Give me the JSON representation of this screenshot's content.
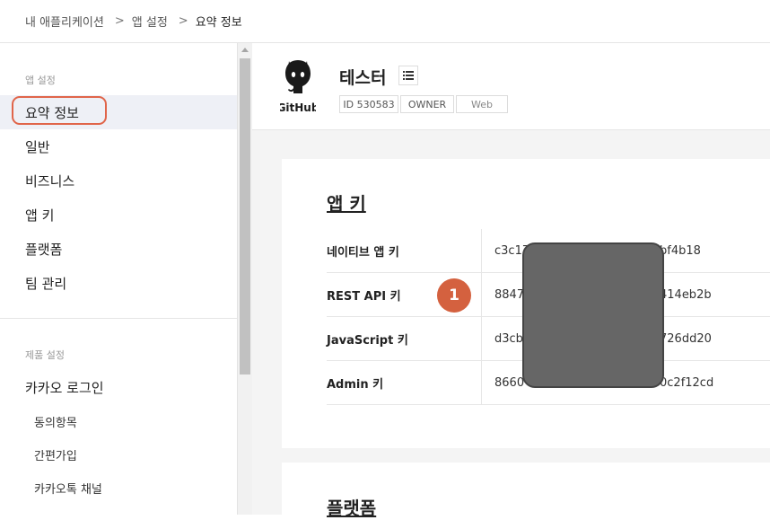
{
  "breadcrumb": {
    "items": [
      "내 애플리케이션",
      "앱 설정",
      "요약 정보"
    ],
    "separator": ">"
  },
  "sidebar": {
    "app_section_title": "앱 설정",
    "app_items": [
      "요약 정보",
      "일반",
      "비즈니스",
      "앱 키",
      "플랫폼",
      "팀 관리"
    ],
    "active_item": "요약 정보",
    "product_section_title": "제품 설정",
    "product_items": [
      "카카오 로그인"
    ],
    "product_sub_items": [
      "동의항목",
      "간편가입",
      "카카오톡 채널"
    ]
  },
  "app": {
    "name": "테스터",
    "logo_text": "GitHub",
    "badges": [
      "ID 530583",
      "OWNER",
      "Web"
    ]
  },
  "app_keys": {
    "title": "앱 키",
    "rows": [
      {
        "label": "네이티브 앱 키",
        "value_start": "c3c17",
        "value_end": "bf4b18"
      },
      {
        "label": "REST API 키",
        "value_start": "8847",
        "value_end": "414eb2b"
      },
      {
        "label": "JavaScript 키",
        "value_start": "d3cb",
        "value_end": "726dd20"
      },
      {
        "label": "Admin 키",
        "value_start": "8660",
        "value_end": "0c2f12cd"
      }
    ]
  },
  "platform": {
    "title": "플랫폼"
  },
  "annotation": {
    "step_number": "1"
  },
  "colors": {
    "highlight_outline": "#e0654a",
    "step_badge": "#d4613f",
    "redaction": "#666666",
    "active_row": "#eef0f6"
  }
}
